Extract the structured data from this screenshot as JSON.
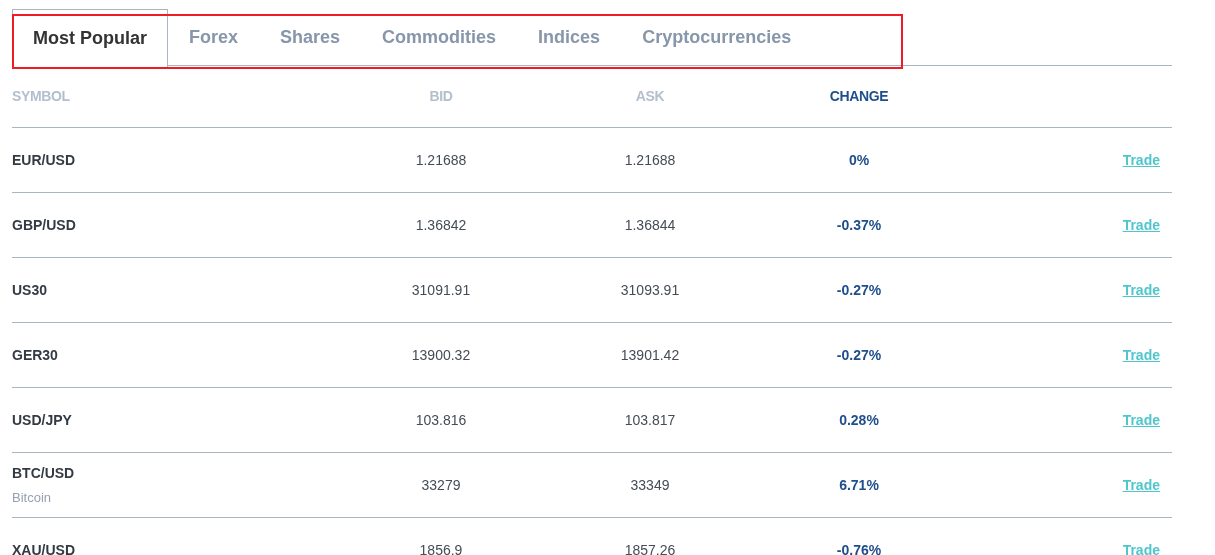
{
  "tabs": [
    {
      "label": "Most Popular",
      "selected": true
    },
    {
      "label": "Forex",
      "selected": false
    },
    {
      "label": "Shares",
      "selected": false
    },
    {
      "label": "Commodities",
      "selected": false
    },
    {
      "label": "Indices",
      "selected": false
    },
    {
      "label": "Cryptocurrencies",
      "selected": false
    }
  ],
  "table": {
    "columns": [
      {
        "label": "SYMBOL",
        "sorted": false
      },
      {
        "label": "BID",
        "sorted": false
      },
      {
        "label": "ASK",
        "sorted": false
      },
      {
        "label": "CHANGE",
        "sorted": true
      }
    ],
    "rows": [
      {
        "symbol": "EUR/USD",
        "bid": "1.21688",
        "ask": "1.21688",
        "change": "0%",
        "action": "Trade"
      },
      {
        "symbol": "GBP/USD",
        "bid": "1.36842",
        "ask": "1.36844",
        "change": "-0.37%",
        "action": "Trade"
      },
      {
        "symbol": "US30",
        "bid": "31091.91",
        "ask": "31093.91",
        "change": "-0.27%",
        "action": "Trade"
      },
      {
        "symbol": "GER30",
        "bid": "13900.32",
        "ask": "13901.42",
        "change": "-0.27%",
        "action": "Trade"
      },
      {
        "symbol": "USD/JPY",
        "bid": "103.816",
        "ask": "103.817",
        "change": "0.28%",
        "action": "Trade"
      },
      {
        "symbol": "BTC/USD",
        "name": "Bitcoin",
        "bid": "33279",
        "ask": "33349",
        "change": "6.71%",
        "action": "Trade"
      },
      {
        "symbol": "XAU/USD",
        "bid": "1856.9",
        "ask": "1857.26",
        "change": "-0.76%",
        "action": "Trade"
      }
    ]
  }
}
